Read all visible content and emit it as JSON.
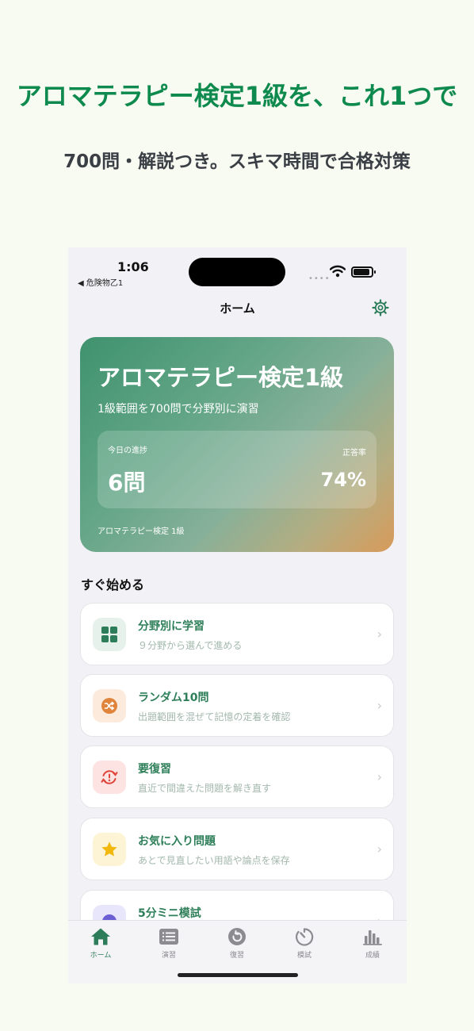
{
  "promo": {
    "title": "アロマテラピー検定1級を、これ1つで",
    "subtitle": "700問・解説つき。スキマ時間で合格対策"
  },
  "status": {
    "time": "1:06",
    "back_app": "◀ 危険物乙1"
  },
  "nav": {
    "title": "ホーム"
  },
  "hero": {
    "title": "アロマテラピー検定1級",
    "subtitle": "1級範囲を700問で分野別に演習",
    "progress_label": "今日の進捗",
    "progress_value": "6問",
    "accuracy_label": "正答率",
    "accuracy_value": "74%",
    "footer": "アロマテラピー検定 1級"
  },
  "section_title": "すぐ始める",
  "menu": [
    {
      "title": "分野別に学習",
      "desc": "９分野から選んで進める",
      "icon": "grid-icon",
      "color": "#2e7d5a",
      "bg": "#e5f1ea"
    },
    {
      "title": "ランダム10問",
      "desc": "出題範囲を混ぜて記憶の定着を確認",
      "icon": "shuffle-icon",
      "color": "#e0843c",
      "bg": "#fcebdc"
    },
    {
      "title": "要復習",
      "desc": "直近で間違えた問題を解き直す",
      "icon": "review-alert-icon",
      "color": "#e0453c",
      "bg": "#fde3e1"
    },
    {
      "title": "お気に入り問題",
      "desc": "あとで見直したい用語や論点を保存",
      "icon": "star-icon",
      "color": "#f1b80b",
      "bg": "#fdf4d6"
    },
    {
      "title": "5分ミニ模試",
      "desc": "",
      "icon": "timer-icon",
      "color": "#6b5fd3",
      "bg": "#e8e6fb"
    }
  ],
  "tabs": [
    {
      "label": "ホーム",
      "icon": "home-icon"
    },
    {
      "label": "演習",
      "icon": "list-icon"
    },
    {
      "label": "復習",
      "icon": "review-icon"
    },
    {
      "label": "模試",
      "icon": "timer-icon"
    },
    {
      "label": "成績",
      "icon": "bar-chart-icon"
    }
  ],
  "colors": {
    "accent": "#2e7d5a",
    "promo_title": "#0f8a4e",
    "tab_inactive": "#8c8c90"
  }
}
